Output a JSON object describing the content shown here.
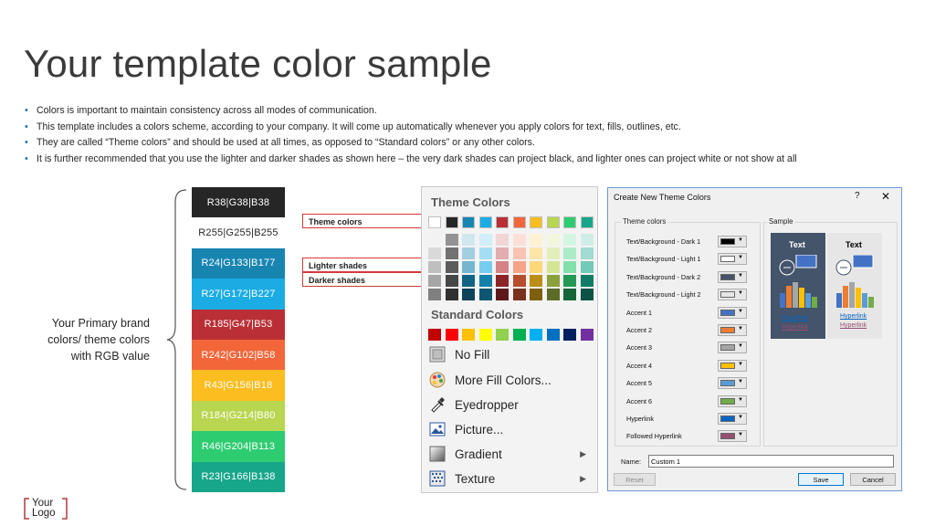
{
  "title": "Your template color sample",
  "bullets": [
    "Colors is important to maintain consistency across all modes of communication.",
    "This template includes a colors scheme, according to your company. It will come up automatically whenever you apply colors for text, fills, outlines, etc.",
    "They are called “Theme colors” and should be used at all times, as opposed to “Standard colors” or any other colors.",
    "It is further recommended that you use the lighter and darker shades as shown here – the very dark shades can project black, and lighter ones can project white or not show at all"
  ],
  "brand_label": [
    "Your Primary brand",
    "colors/ theme colors",
    "with RGB value"
  ],
  "swatches": [
    {
      "label": "R38|G38|B38",
      "color": "#262626",
      "text": "#ffffff"
    },
    {
      "label": "R255|G255|B255",
      "color": "#ffffff",
      "text": "#262626"
    },
    {
      "label": "R24|G133|B177",
      "color": "#1885b1",
      "text": "#ffffff"
    },
    {
      "label": "R27|G172|B227",
      "color": "#1bace3",
      "text": "#ffffff"
    },
    {
      "label": "R185|G47|B53",
      "color": "#b92f35",
      "text": "#ffffff"
    },
    {
      "label": "R242|G102|B58",
      "color": "#f2663a",
      "text": "#ffffff"
    },
    {
      "label": "R43|G156|B18",
      "color": "#fbbd1f",
      "text": "#ffffff"
    },
    {
      "label": "R184|G214|B80",
      "color": "#b8d650",
      "text": "#ffffff"
    },
    {
      "label": "R46|G204|B113",
      "color": "#2ecc71",
      "text": "#ffffff"
    },
    {
      "label": "R23|G166|B138",
      "color": "#17a68a",
      "text": "#ffffff"
    }
  ],
  "annotations": {
    "theme": "Theme colors",
    "lighter": "Lighter shades",
    "darker": "Darker shades"
  },
  "fill_menu": {
    "theme_header": "Theme Colors",
    "standard_header": "Standard Colors",
    "theme_colors": [
      "#ffffff",
      "#262626",
      "#1885b1",
      "#1bace3",
      "#b92f35",
      "#f2663a",
      "#fbbd1f",
      "#b8d650",
      "#2ecc71",
      "#17a68a"
    ],
    "standard_colors": [
      "#c00000",
      "#ff0000",
      "#ffc000",
      "#ffff00",
      "#92d050",
      "#00b050",
      "#00b0f0",
      "#0070c0",
      "#002060",
      "#7030a0"
    ],
    "items": [
      {
        "label": "No Fill",
        "icon": "no-fill-icon",
        "submenu": false
      },
      {
        "label": "More Fill Colors...",
        "icon": "color-palette-icon",
        "submenu": false
      },
      {
        "label": "Eyedropper",
        "icon": "eyedropper-icon",
        "submenu": false
      },
      {
        "label": "Picture...",
        "icon": "picture-icon",
        "submenu": false
      },
      {
        "label": "Gradient",
        "icon": "gradient-icon",
        "submenu": true
      },
      {
        "label": "Texture",
        "icon": "texture-icon",
        "submenu": true
      }
    ]
  },
  "dialog": {
    "title": "Create New Theme Colors",
    "help": "?",
    "close": "✕",
    "theme_group": "Theme colors",
    "sample_group": "Sample",
    "rows": [
      {
        "label": "Text/Background - Dark 1",
        "color": "#000000"
      },
      {
        "label": "Text/Background - Light 1",
        "color": "#ffffff"
      },
      {
        "label": "Text/Background - Dark 2",
        "color": "#44546a"
      },
      {
        "label": "Text/Background - Light 2",
        "color": "#e7e6e6"
      },
      {
        "label": "Accent 1",
        "color": "#4472c4"
      },
      {
        "label": "Accent 2",
        "color": "#ed7d31"
      },
      {
        "label": "Accent 3",
        "color": "#a5a5a5"
      },
      {
        "label": "Accent 4",
        "color": "#ffc000"
      },
      {
        "label": "Accent 5",
        "color": "#5b9bd5"
      },
      {
        "label": "Accent 6",
        "color": "#70ad47"
      },
      {
        "label": "Hyperlink",
        "color": "#0563c1"
      },
      {
        "label": "Followed Hyperlink",
        "color": "#954f72"
      }
    ],
    "sample_text": "Text",
    "sample_link": "Hyperlink",
    "name_label": "Name:",
    "name_value": "Custom 1",
    "reset": "Reset",
    "save": "Save",
    "cancel": "Cancel"
  },
  "logo": [
    "Your",
    "Logo"
  ]
}
